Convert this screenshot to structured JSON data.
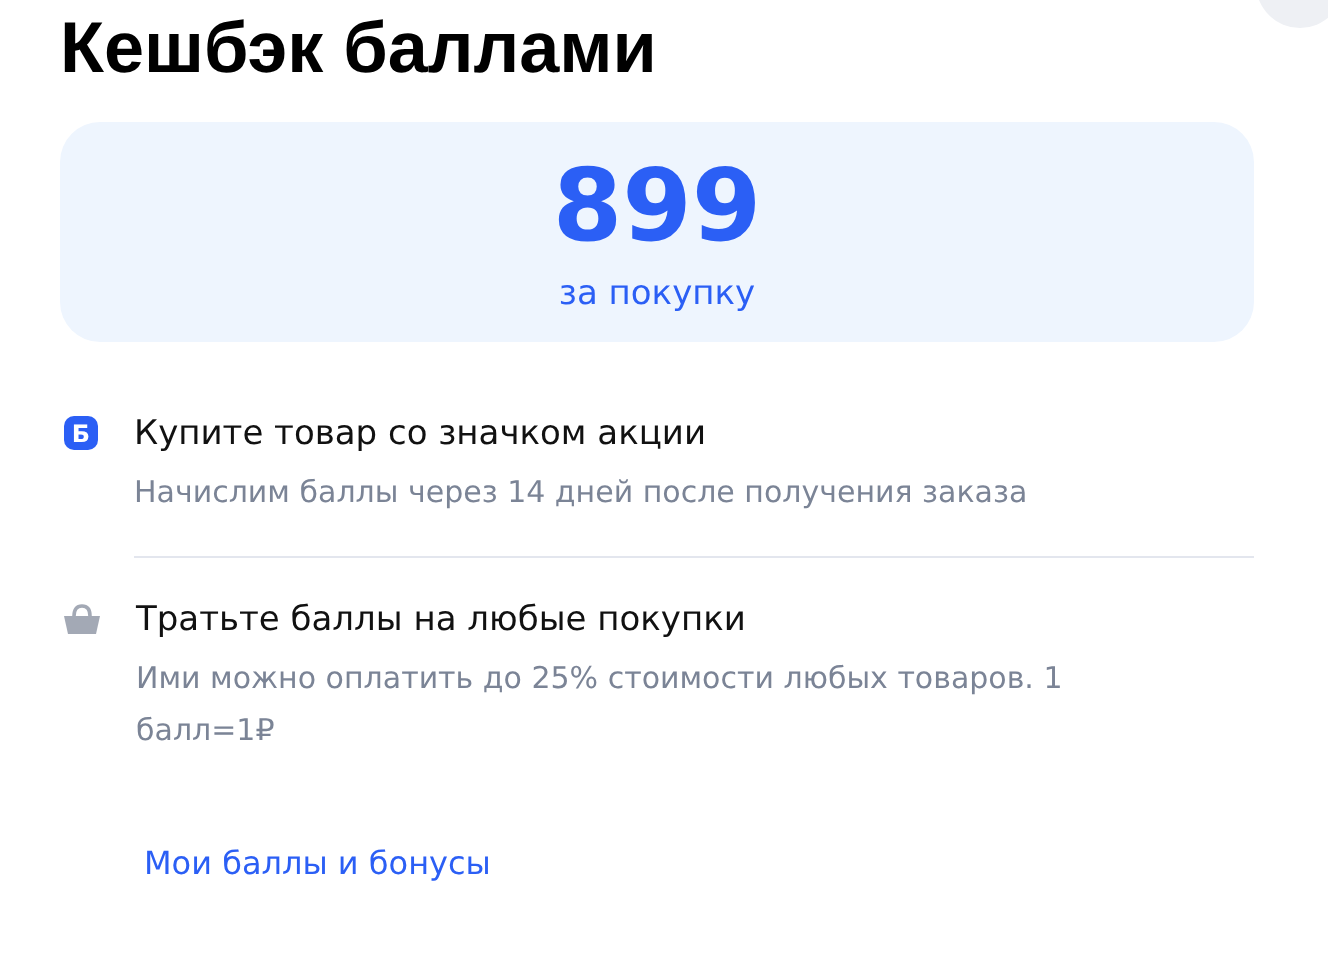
{
  "title": "Кешбэк баллами",
  "summary": {
    "value": "899",
    "caption": "за покупку"
  },
  "steps": [
    {
      "kind": "badge",
      "icon_text": "Б",
      "title": "Купите товар со значком акции",
      "text": "Начислим баллы через 14 дней после получения заказа"
    },
    {
      "kind": "basket",
      "title": "Тратьте баллы на любые покупки",
      "text": "Ими можно оплатить до 25% стоимости любых товаров. 1 балл=1₽"
    }
  ],
  "link": "Мои баллы и бонусы"
}
